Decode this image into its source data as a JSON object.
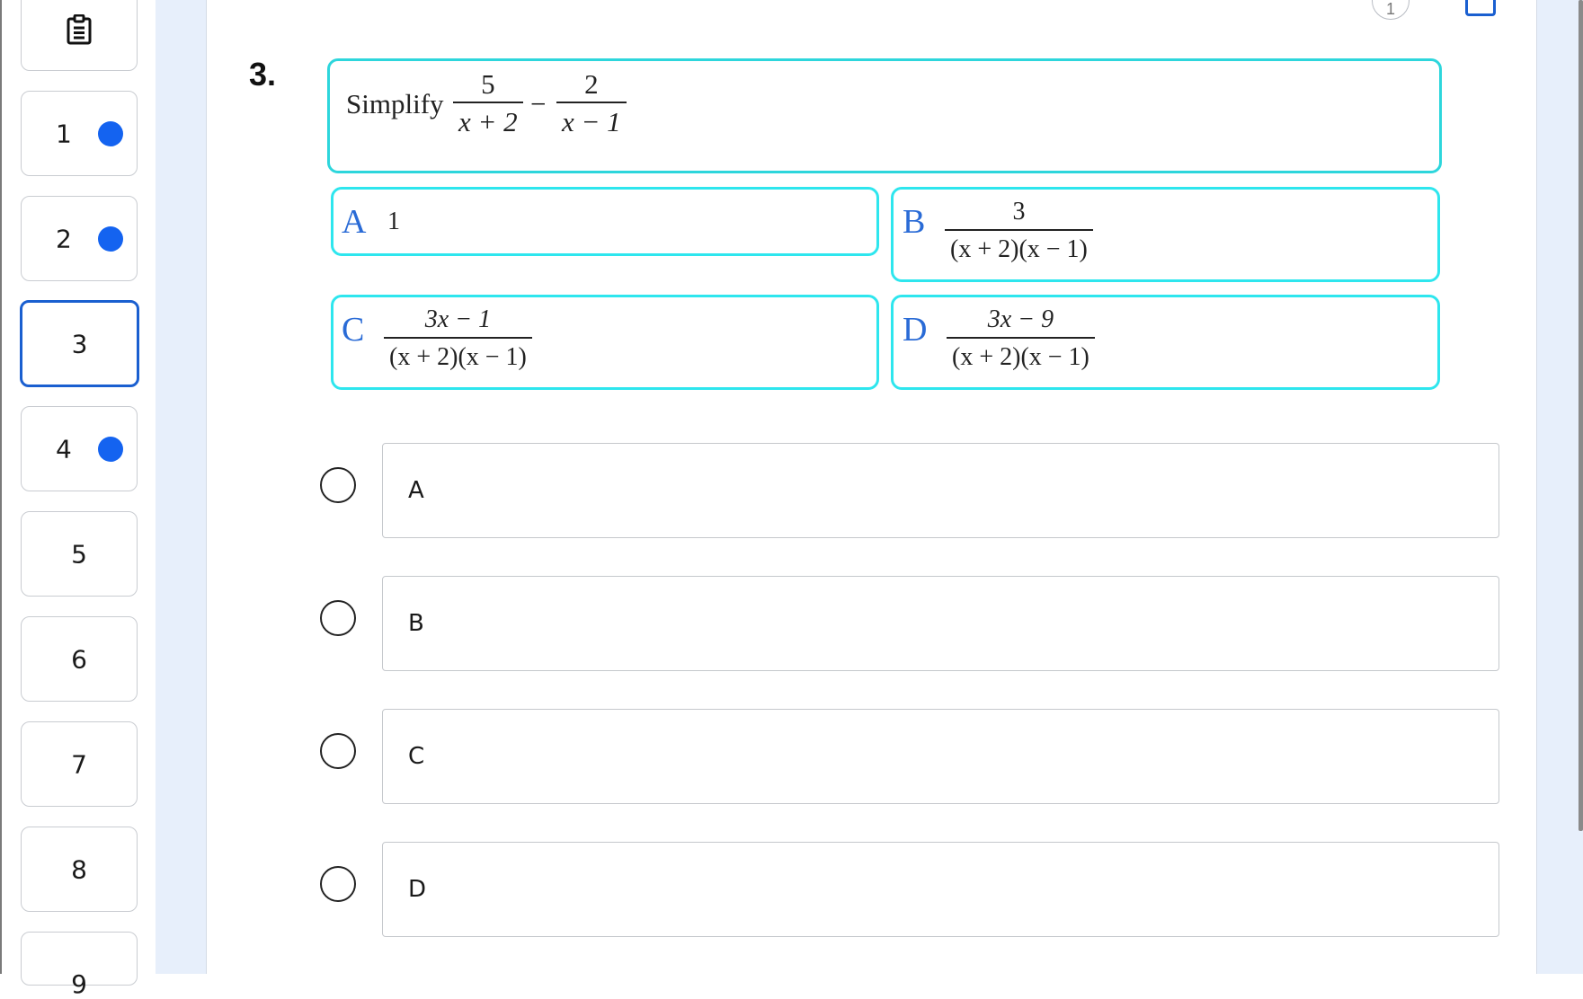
{
  "nav": {
    "items": [
      {
        "label": "1",
        "answered": true
      },
      {
        "label": "2",
        "answered": true
      },
      {
        "label": "3",
        "answered": false,
        "current": true
      },
      {
        "label": "4",
        "answered": true
      },
      {
        "label": "5",
        "answered": false
      },
      {
        "label": "6",
        "answered": false
      },
      {
        "label": "7",
        "answered": false
      },
      {
        "label": "8",
        "answered": false
      },
      {
        "label": "9",
        "answered": false
      }
    ]
  },
  "header": {
    "counter": "1"
  },
  "question": {
    "number": "3.",
    "prompt": "Simplify",
    "expr": {
      "f1_num": "5",
      "f1_den": "x + 2",
      "op": "−",
      "f2_num": "2",
      "f2_den": "x − 1"
    }
  },
  "options": {
    "A": {
      "letter": "A",
      "value": "1"
    },
    "B": {
      "letter": "B",
      "num": "3",
      "den": "(x + 2)(x − 1)"
    },
    "C": {
      "letter": "C",
      "num": "3x − 1",
      "den": "(x + 2)(x − 1)"
    },
    "D": {
      "letter": "D",
      "num": "3x − 9",
      "den": "(x + 2)(x − 1)"
    }
  },
  "answers": [
    "A",
    "B",
    "C",
    "D"
  ],
  "colors": {
    "accent": "#1463f0",
    "option_border": "#2ee6ee",
    "option_letter": "#2a6bd6",
    "gutter": "#e7effb"
  }
}
